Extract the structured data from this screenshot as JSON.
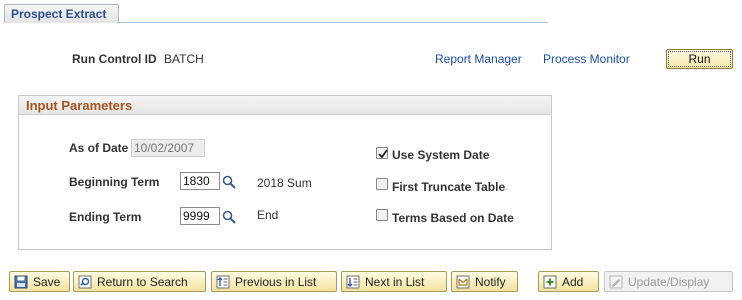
{
  "tab": {
    "label": "Prospect Extract"
  },
  "run_control": {
    "label": "Run Control ID",
    "value": "BATCH"
  },
  "links": {
    "report_manager": "Report Manager",
    "process_monitor": "Process Monitor"
  },
  "run_button": "Run",
  "input_parameters": {
    "title": "Input Parameters",
    "as_of_date": {
      "label": "As of Date",
      "value": "10/02/2007"
    },
    "beginning_term": {
      "label": "Beginning Term",
      "value": "1830",
      "description": "2018 Sum"
    },
    "ending_term": {
      "label": "Ending Term",
      "value": "9999",
      "description": "End"
    },
    "checkboxes": {
      "use_system_date": {
        "label": "Use System Date",
        "checked": true
      },
      "first_truncate_table": {
        "label": "First Truncate Table",
        "checked": false
      },
      "terms_based_on_date": {
        "label": "Terms Based on Date",
        "checked": false
      }
    }
  },
  "toolbar": {
    "save": "Save",
    "return_to_search": "Return to Search",
    "previous_in_list": "Previous in List",
    "next_in_list": "Next in List",
    "notify": "Notify",
    "add": "Add",
    "update_display": "Update/Display"
  },
  "colors": {
    "link": "#1b4ea0",
    "group_title": "#a4531e",
    "button_fill": "#f3e3a0",
    "tab_text": "#2b4f8f"
  }
}
